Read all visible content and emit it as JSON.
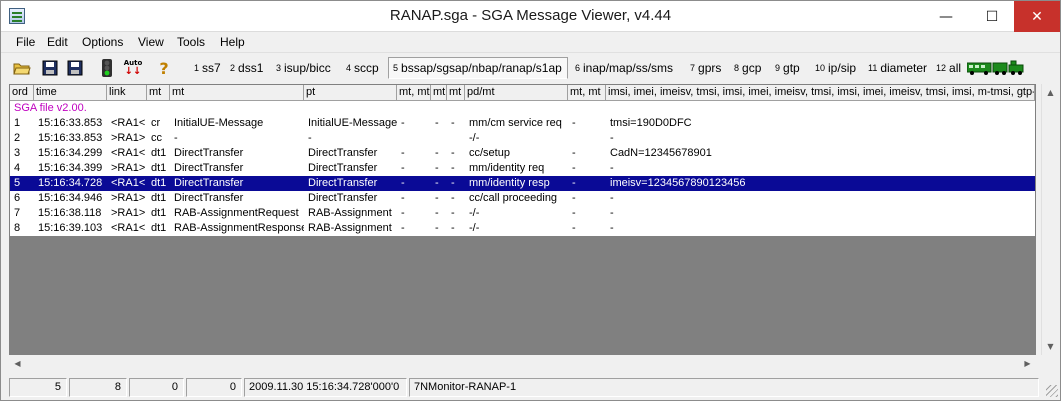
{
  "window": {
    "title": "RANAP.sga - SGA Message Viewer, v4.44",
    "minimize_glyph": "—",
    "maximize_glyph": "☐",
    "close_glyph": "✕"
  },
  "menu": [
    "File",
    "Edit",
    "Options",
    "View",
    "Tools",
    "Help"
  ],
  "toolbar": {
    "icons": [
      "open-folder-icon",
      "save-icon",
      "save-as-icon",
      "traffic-light-icon",
      "auto-scroll-icon",
      "help-icon"
    ],
    "auto_label": "Auto",
    "help_glyph": "?",
    "protocol_tabs": [
      {
        "num": "1",
        "label": "ss7"
      },
      {
        "num": "2",
        "label": "dss1"
      },
      {
        "num": "3",
        "label": "isup/bicc"
      },
      {
        "num": "4",
        "label": "sccp"
      },
      {
        "num": "5",
        "label": "bssap/sgsap/nbap/ranap/s1ap"
      },
      {
        "num": "6",
        "label": "inap/map/ss/sms"
      },
      {
        "num": "7",
        "label": "gprs"
      },
      {
        "num": "8",
        "label": "gcp"
      },
      {
        "num": "9",
        "label": "gtp"
      },
      {
        "num": "10",
        "label": "ip/sip"
      },
      {
        "num": "11",
        "label": "diameter"
      },
      {
        "num": "12",
        "label": "all"
      }
    ],
    "active_tab": "bssap/sgsap/nbap/ranap/s1ap"
  },
  "grid": {
    "columns": [
      "ord",
      "time",
      "link",
      "mt",
      "mt",
      "pt",
      "mt, mt",
      "mt",
      "mt",
      "pd/mt",
      "mt, mt",
      "imsi, imei, imeisv, tmsi, imsi, imei, imeisv, tmsi, imsi, imei, imeisv, tmsi, imsi, m-tmsi, gtp-tei, mm"
    ],
    "header_line": "SGA file v2.00.",
    "rows": [
      {
        "ord": "1",
        "time": "15:16:33.853",
        "link": "<RA1<",
        "mt1": "cr",
        "mt2": "InitialUE-Message",
        "pt": "InitialUE-Message",
        "mtmt": "-",
        "mt3": "-",
        "mt4": "-",
        "pdmt": "mm/cm service req",
        "mtmt2": "-",
        "ids": "tmsi=190D0DFC"
      },
      {
        "ord": "2",
        "time": "15:16:33.853",
        "link": ">RA1>",
        "mt1": "cc",
        "mt2": "-",
        "pt": "-",
        "mtmt": "",
        "mt3": "",
        "mt4": "",
        "pdmt": "-/-",
        "mtmt2": "",
        "ids": "-"
      },
      {
        "ord": "3",
        "time": "15:16:34.299",
        "link": "<RA1<",
        "mt1": "dt1",
        "mt2": "DirectTransfer",
        "pt": "DirectTransfer",
        "mtmt": "-",
        "mt3": "-",
        "mt4": "-",
        "pdmt": "cc/setup",
        "mtmt2": "-",
        "ids": "CadN=12345678901"
      },
      {
        "ord": "4",
        "time": "15:16:34.399",
        "link": ">RA1>",
        "mt1": "dt1",
        "mt2": "DirectTransfer",
        "pt": "DirectTransfer",
        "mtmt": "-",
        "mt3": "-",
        "mt4": "-",
        "pdmt": "mm/identity req",
        "mtmt2": "-",
        "ids": "-"
      },
      {
        "ord": "5",
        "time": "15:16:34.728",
        "link": "<RA1<",
        "mt1": "dt1",
        "mt2": "DirectTransfer",
        "pt": "DirectTransfer",
        "mtmt": "-",
        "mt3": "-",
        "mt4": "-",
        "pdmt": "mm/identity resp",
        "mtmt2": "-",
        "ids": "imeisv=1234567890123456"
      },
      {
        "ord": "6",
        "time": "15:16:34.946",
        "link": ">RA1>",
        "mt1": "dt1",
        "mt2": "DirectTransfer",
        "pt": "DirectTransfer",
        "mtmt": "-",
        "mt3": "-",
        "mt4": "-",
        "pdmt": "cc/call proceeding",
        "mtmt2": "-",
        "ids": "-"
      },
      {
        "ord": "7",
        "time": "15:16:38.118",
        "link": ">RA1>",
        "mt1": "dt1",
        "mt2": "RAB-AssignmentRequest",
        "pt": "RAB-Assignment",
        "mtmt": "-",
        "mt3": "-",
        "mt4": "-",
        "pdmt": "-/-",
        "mtmt2": "-",
        "ids": "-"
      },
      {
        "ord": "8",
        "time": "15:16:39.103",
        "link": "<RA1<",
        "mt1": "dt1",
        "mt2": "RAB-AssignmentResponse",
        "pt": "RAB-Assignment",
        "mtmt": "-",
        "mt3": "-",
        "mt4": "-",
        "pdmt": "-/-",
        "mtmt2": "-",
        "ids": "-"
      }
    ],
    "selected_row": 5
  },
  "scroll": {
    "up": "▲",
    "down": "▼",
    "left": "◀",
    "right": "▶"
  },
  "status": {
    "f1": "5",
    "f2": "8",
    "f3": "0",
    "f4": "0",
    "datetime": "2009.11.30  15:16:34.728'000'0",
    "source": "7NMonitor-RANAP-1"
  },
  "colors": {
    "selection": "#0a0a96",
    "sga_file": "#c000c0",
    "close_button": "#c7312b"
  }
}
